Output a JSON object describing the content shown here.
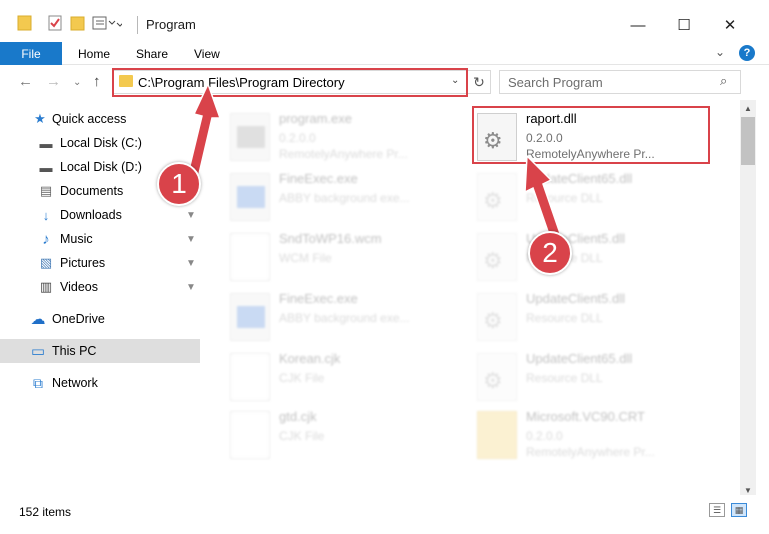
{
  "window": {
    "title": "Program",
    "minimize": "—",
    "maximize": "☐",
    "close": "✕"
  },
  "ribbon": {
    "tabs": [
      "File",
      "Home",
      "Share",
      "View"
    ],
    "expand": "⌄",
    "help": "?"
  },
  "nav": {
    "back": "←",
    "forward": "→",
    "recent": "⌄",
    "up": "↑",
    "address": "C:\\Program Files\\Program Directory",
    "address_chevron": "⌄",
    "refresh": "↻",
    "search_placeholder": "Search Program",
    "search_icon": "⌕"
  },
  "sidebar": {
    "items": [
      {
        "label": "Quick access",
        "icon": "star-icon",
        "glyph": "★",
        "pinned": false
      },
      {
        "label": "Local Disk (C:)",
        "icon": "drive-icon",
        "glyph": "▬",
        "pinned": false
      },
      {
        "label": "Local Disk (D:)",
        "icon": "drive-icon",
        "glyph": "▬",
        "pinned": false
      },
      {
        "label": "Documents",
        "icon": "documents-icon",
        "glyph": "▤",
        "pinned": false
      },
      {
        "label": "Downloads",
        "icon": "download-icon",
        "glyph": "↓",
        "pinned": true
      },
      {
        "label": "Music",
        "icon": "music-icon",
        "glyph": "♪",
        "pinned": true
      },
      {
        "label": "Pictures",
        "icon": "pictures-icon",
        "glyph": "▧",
        "pinned": true
      },
      {
        "label": "Videos",
        "icon": "videos-icon",
        "glyph": "▥",
        "pinned": true
      },
      {
        "label": "OneDrive",
        "icon": "cloud-icon",
        "glyph": "☁",
        "pinned": false
      },
      {
        "label": "This PC",
        "icon": "computer-icon",
        "glyph": "▭",
        "pinned": false,
        "selected": true
      },
      {
        "label": "Network",
        "icon": "network-icon",
        "glyph": "⧉",
        "pinned": false
      }
    ],
    "pin_glyph": "📌"
  },
  "files": [
    {
      "name": "program.exe",
      "sub1": "0.2.0.0",
      "sub2": "RemotelyAnywhere Pr...",
      "icon": "exe-icon",
      "kind": "exe",
      "faded": true
    },
    {
      "name": "raport.dll",
      "sub1": "0.2.0.0",
      "sub2": "RemotelyAnywhere Pr...",
      "icon": "dll-icon",
      "kind": "dll",
      "faded": false,
      "highlighted": true
    },
    {
      "name": "FineExec.exe",
      "sub1": "ABBY background exe...",
      "sub2": "",
      "icon": "exe-icon",
      "kind": "exe",
      "faded": true
    },
    {
      "name": "UpdateClient65.dll",
      "sub1": "Resource DLL",
      "sub2": "",
      "icon": "dll-icon",
      "kind": "dll",
      "faded": true
    },
    {
      "name": "SndToWP16.wcm",
      "sub1": "WCM File",
      "sub2": "",
      "icon": "document-icon",
      "kind": "doc",
      "faded": true
    },
    {
      "name": "UpdateClient5.dll",
      "sub1": "Resource DLL",
      "sub2": "",
      "icon": "dll-icon",
      "kind": "dll",
      "faded": true
    },
    {
      "name": "FineExec.exe",
      "sub1": "ABBY background exe...",
      "sub2": "",
      "icon": "exe-icon",
      "kind": "exe",
      "faded": true
    },
    {
      "name": "UpdateClient5.dll",
      "sub1": "Resource DLL",
      "sub2": "",
      "icon": "dll-icon",
      "kind": "dll",
      "faded": true
    },
    {
      "name": "Korean.cjk",
      "sub1": "CJK File",
      "sub2": "",
      "icon": "document-icon",
      "kind": "doc",
      "faded": true
    },
    {
      "name": "UpdateClient65.dll",
      "sub1": "Resource DLL",
      "sub2": "",
      "icon": "dll-icon",
      "kind": "dll",
      "faded": true
    },
    {
      "name": "gtd.cjk",
      "sub1": "CJK File",
      "sub2": "",
      "icon": "document-icon",
      "kind": "doc",
      "faded": true
    },
    {
      "name": "Microsoft.VC90.CRT",
      "sub1": "0.2.0.0",
      "sub2": "RemotelyAnywhere Pr...",
      "icon": "folder-icon",
      "kind": "folder",
      "faded": true
    }
  ],
  "status": {
    "item_count": "152 items"
  },
  "annotations": {
    "step1": "1",
    "step2": "2",
    "color": "#d9434a"
  }
}
